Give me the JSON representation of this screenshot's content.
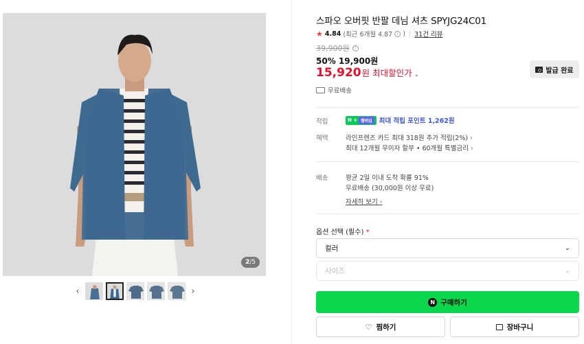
{
  "gallery": {
    "counter_current": "2",
    "counter_total": "/5",
    "prev_arrow": "‹",
    "next_arrow": "›",
    "thumb_count": 5,
    "active_thumb_index": 1
  },
  "product": {
    "title": "스파오 오버핏 반팔 데님 셔츠 SPYJG24C01",
    "rating_star": "★",
    "rating_score": "4.84",
    "rating_recent": "(최근 6개월 4.87",
    "rating_recent_close": ")",
    "rating_sep": "|",
    "review_count": "31건 리뷰",
    "original_price": "39,900원",
    "discount_text": "50% 19,900원",
    "final_price": "15,920",
    "final_price_unit": "원",
    "max_discount_label": "최대할인가",
    "coupon_button": "발급 완료",
    "shipping_badge": "무료배송"
  },
  "benefits": {
    "points_label": "적립",
    "points_npay_badge": "N +",
    "points_member_badge": "멤버십",
    "points_text": "최대 적립 포인트 1,262원",
    "benefit_label": "혜택",
    "benefit_line1": "라인프렌즈 카드 최대 318원 추가 적립(2%)",
    "benefit_line2": "최대 12개월 무이자 할부 • 60개월 특별금리",
    "delivery_label": "배송",
    "delivery_line1": "평균 2일 이내 도착 확률 91%",
    "delivery_line2": "무료배송 (30,000원 이상 무료)",
    "detail_link": "자세히 보기"
  },
  "options": {
    "label": "옵션 선택 (필수)",
    "required_mark": "*",
    "color_select": "컬러",
    "size_select": "사이즈"
  },
  "actions": {
    "buy_label": "구매하기",
    "wish_label": "찜하기",
    "cart_label": "장바구니"
  },
  "colors": {
    "buy_green": "#0bd64c",
    "price_red": "#e8102a",
    "points_blue": "#3d57d8"
  }
}
